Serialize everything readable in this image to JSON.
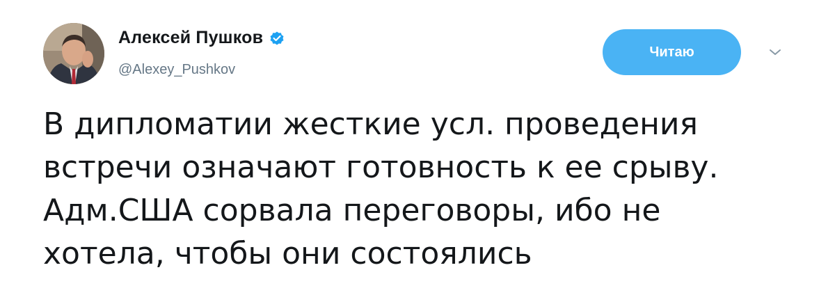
{
  "author": {
    "display_name": "Алексей Пушков",
    "handle": "@Alexey_Pushkov",
    "verified": true,
    "avatar_icon": "profile-photo"
  },
  "actions": {
    "follow_label": "Читаю",
    "more_icon": "chevron-down-icon"
  },
  "tweet": {
    "lines": [
      "В дипломатии жесткие усл. проведения",
      "встречи означают готовность к ее срыву.",
      "Адм.США сорвала переговоры, ибо не",
      "хотела, чтобы они состоялись"
    ]
  },
  "colors": {
    "accent": "#4ab3f4",
    "verified": "#1da1f2",
    "text": "#14171a",
    "secondary": "#657786"
  }
}
